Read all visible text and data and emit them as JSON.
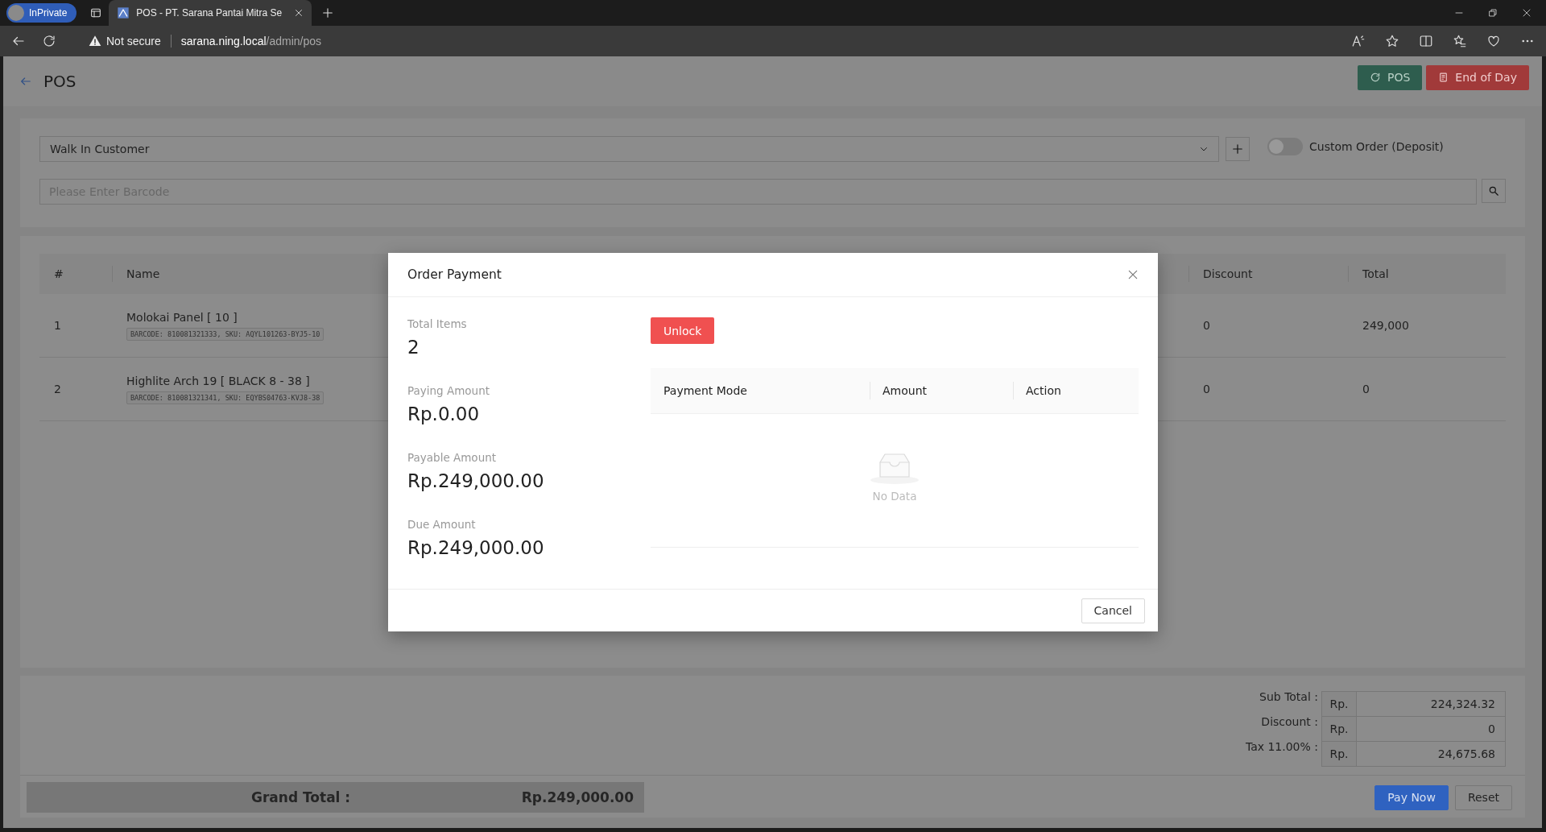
{
  "browser": {
    "profile": "InPrivate",
    "tab_title": "POS - PT. Sarana Pantai Mitra Se",
    "security": "Not secure",
    "url_host": "sarana.ning.local",
    "url_path": "/admin/pos"
  },
  "header": {
    "title": "POS",
    "buttons": [
      {
        "label": "POS",
        "kind": "refresh"
      },
      {
        "label": "End of Day",
        "kind": "report"
      }
    ]
  },
  "customer": {
    "value": "Walk In Customer"
  },
  "custom_order": {
    "label": "Custom Order (Deposit)",
    "on": false
  },
  "barcode": {
    "placeholder": "Please Enter Barcode"
  },
  "table": {
    "columns": [
      "#",
      "Name",
      "Discount",
      "Total"
    ],
    "rows": [
      {
        "index": "1",
        "name": "Molokai Panel [ 10 ]",
        "code": "BARCODE: 810081321333, SKU: AQYL101263-BYJ5-10",
        "discount": "0",
        "total": "249,000"
      },
      {
        "index": "2",
        "name": "Highlite Arch 19 [ BLACK 8 - 38 ]",
        "code": "BARCODE: 810081321341, SKU: EQYBS04763-KVJ8-38",
        "discount": "0",
        "total": "0"
      }
    ]
  },
  "summary": {
    "lines": [
      {
        "label": "Sub Total :",
        "prefix": "Rp.",
        "value": "224,324.32"
      },
      {
        "label": "Discount :",
        "prefix": "Rp.",
        "value": "0"
      },
      {
        "label": "Tax 11.00% :",
        "prefix": "Rp.",
        "value": "24,675.68"
      }
    ],
    "grand_total_label": "Grand Total :",
    "grand_total": "Rp.249,000.00",
    "buttons": [
      {
        "label": "Pay Now",
        "kind": "primary"
      },
      {
        "label": "Reset",
        "kind": "default"
      }
    ]
  },
  "modal": {
    "title": "Order Payment",
    "stats": [
      {
        "label": "Total Items",
        "value": "2"
      },
      {
        "label": "Paying Amount",
        "value": "Rp.0.00"
      },
      {
        "label": "Payable Amount",
        "value": "Rp.249,000.00"
      },
      {
        "label": "Due Amount",
        "value": "Rp.249,000.00"
      }
    ],
    "unlock": "Unlock",
    "columns": [
      "Payment Mode",
      "Amount",
      "Action"
    ],
    "empty": "No Data",
    "cancel": "Cancel"
  }
}
